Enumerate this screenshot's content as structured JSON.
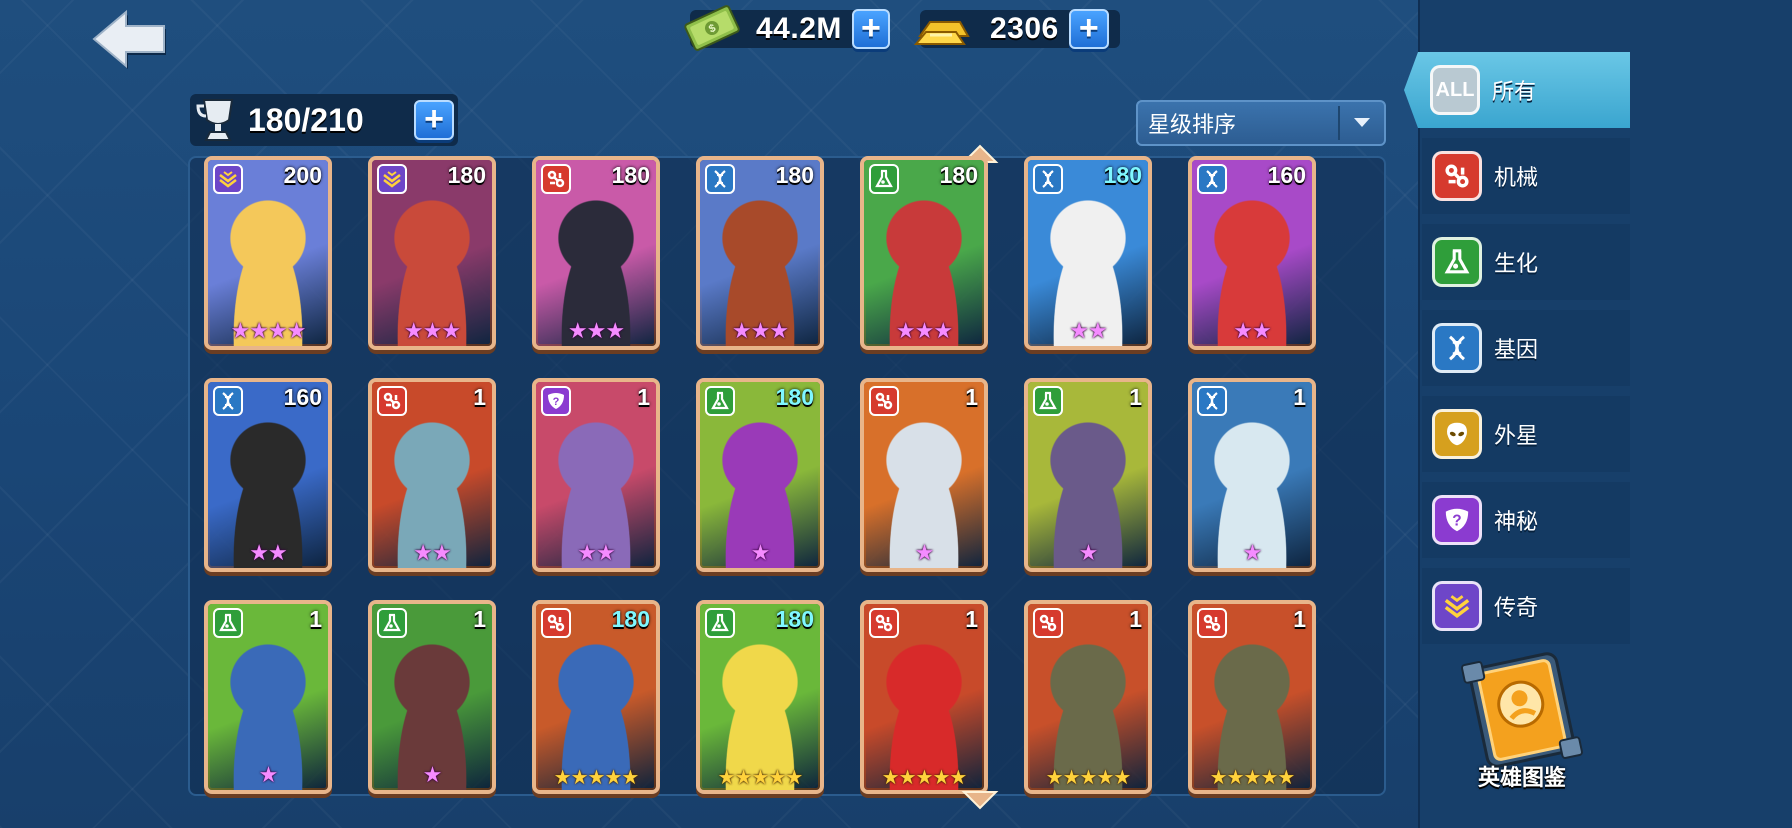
{
  "currencies": {
    "cash": {
      "value": "44.2M",
      "icon": "cash-icon"
    },
    "gold": {
      "value": "2306",
      "icon": "gold-bar-icon"
    }
  },
  "capacity": {
    "value": "180/210",
    "icon": "trophy-cup-icon"
  },
  "sort": {
    "label": "星级排序"
  },
  "class_colors": {
    "mech": "#d63a2e",
    "bio": "#2f9e3a",
    "gene": "#2a78c4",
    "alien": "#d6a01e",
    "mystery": "#8b3bd0",
    "legend": "#6e46c8"
  },
  "filters": [
    {
      "id": "all",
      "label": "所有",
      "icon_text": "ALL"
    },
    {
      "id": "mech",
      "label": "机械",
      "icon": "mech-icon"
    },
    {
      "id": "bio",
      "label": "生化",
      "icon": "flask-icon"
    },
    {
      "id": "gene",
      "label": "基因",
      "icon": "dna-icon"
    },
    {
      "id": "alien",
      "label": "外星",
      "icon": "alien-icon"
    },
    {
      "id": "mystery",
      "label": "神秘",
      "icon": "mystery-icon"
    },
    {
      "id": "legend",
      "label": "传奇",
      "icon": "legend-icon"
    }
  ],
  "codex": {
    "label": "英雄图鉴"
  },
  "heroes": [
    {
      "cls": "legend",
      "level": "200",
      "stars": 4,
      "star_color": "pink",
      "level_color": "white",
      "art": [
        "#6a7fd8",
        "#f4c85a"
      ]
    },
    {
      "cls": "legend",
      "level": "180",
      "stars": 3,
      "star_color": "pink",
      "level_color": "white",
      "art": [
        "#8a3a6a",
        "#c94a3a"
      ]
    },
    {
      "cls": "mech",
      "level": "180",
      "stars": 3,
      "star_color": "pink",
      "level_color": "white",
      "art": [
        "#c95aa8",
        "#2b2b3a"
      ]
    },
    {
      "cls": "gene",
      "level": "180",
      "stars": 3,
      "star_color": "pink",
      "level_color": "white",
      "art": [
        "#5a7ac8",
        "#a84a2a"
      ]
    },
    {
      "cls": "bio",
      "level": "180",
      "stars": 3,
      "star_color": "pink",
      "level_color": "white",
      "art": [
        "#4aa84a",
        "#c83a3a"
      ]
    },
    {
      "cls": "gene",
      "level": "180",
      "stars": 2,
      "star_color": "pink",
      "level_color": "cyan",
      "art": [
        "#3a8ad8",
        "#f0f0f0"
      ]
    },
    {
      "cls": "gene",
      "level": "160",
      "stars": 2,
      "star_color": "pink",
      "level_color": "white",
      "art": [
        "#a84ac8",
        "#d83a3a"
      ]
    },
    {
      "cls": "gene",
      "level": "160",
      "stars": 2,
      "star_color": "pink",
      "level_color": "white",
      "art": [
        "#3a6ac8",
        "#2a2a2a"
      ]
    },
    {
      "cls": "mech",
      "level": "1",
      "stars": 2,
      "star_color": "pink",
      "level_color": "white",
      "art": [
        "#c84a2a",
        "#7aa8b8"
      ]
    },
    {
      "cls": "mystery",
      "level": "1",
      "stars": 2,
      "star_color": "pink",
      "level_color": "white",
      "art": [
        "#c84a6a",
        "#8a6ab8"
      ]
    },
    {
      "cls": "bio",
      "level": "180",
      "stars": 1,
      "star_color": "pink",
      "level_color": "cyan",
      "art": [
        "#8ab83a",
        "#9a3ab8"
      ]
    },
    {
      "cls": "mech",
      "level": "1",
      "stars": 1,
      "star_color": "pink",
      "level_color": "white",
      "art": [
        "#d8702a",
        "#d8e0e8"
      ]
    },
    {
      "cls": "bio",
      "level": "1",
      "stars": 1,
      "star_color": "pink",
      "level_color": "white",
      "art": [
        "#a8b83a",
        "#6a5a8a"
      ]
    },
    {
      "cls": "gene",
      "level": "1",
      "stars": 1,
      "star_color": "pink",
      "level_color": "white",
      "art": [
        "#3a7ab8",
        "#d8e8f0"
      ]
    },
    {
      "cls": "bio",
      "level": "1",
      "stars": 1,
      "star_color": "pink",
      "level_color": "white",
      "art": [
        "#6ab83a",
        "#3a6ab8"
      ]
    },
    {
      "cls": "bio",
      "level": "1",
      "stars": 1,
      "star_color": "pink",
      "level_color": "white",
      "art": [
        "#4a9a3a",
        "#6a3a3a"
      ]
    },
    {
      "cls": "mech",
      "level": "180",
      "stars": 5,
      "star_color": "gold",
      "level_color": "cyan",
      "art": [
        "#c85a2a",
        "#3a6ab8"
      ]
    },
    {
      "cls": "bio",
      "level": "180",
      "stars": 5,
      "star_color": "gold",
      "level_color": "cyan",
      "art": [
        "#6ab83a",
        "#f0d84a"
      ]
    },
    {
      "cls": "mech",
      "level": "1",
      "stars": 5,
      "star_color": "gold",
      "level_color": "white",
      "art": [
        "#c84a2a",
        "#d82a2a"
      ]
    },
    {
      "cls": "mech",
      "level": "1",
      "stars": 5,
      "star_color": "gold",
      "level_color": "white",
      "art": [
        "#c8502a",
        "#6a6a4a"
      ]
    },
    {
      "cls": "mech",
      "level": "1",
      "stars": 5,
      "star_color": "gold",
      "level_color": "white",
      "art": [
        "#c8502a",
        "#6a6a4a"
      ]
    }
  ]
}
